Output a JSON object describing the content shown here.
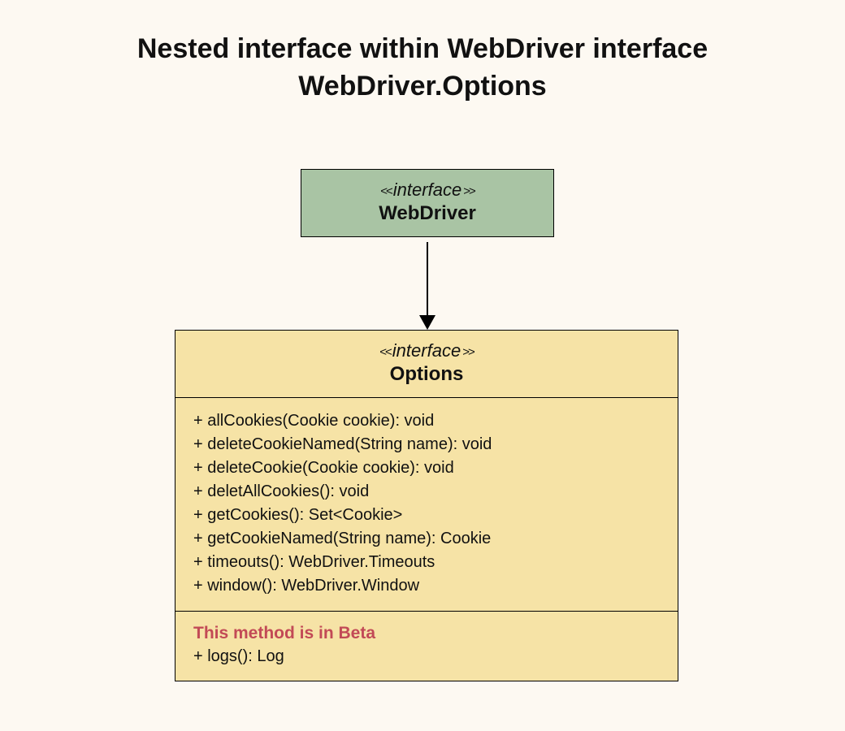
{
  "title_line1": "Nested interface within WebDriver interface",
  "title_line2": "WebDriver.Options",
  "stereotype_open": "<<",
  "stereotype_word": "interface",
  "stereotype_close": ">>",
  "webdriver": {
    "name": "WebDriver"
  },
  "options": {
    "name": "Options",
    "methods": [
      "+ allCookies(Cookie cookie): void",
      "+ deleteCookieNamed(String name): void",
      "+ deleteCookie(Cookie cookie): void",
      "+ deletAllCookies(): void",
      "+ getCookies(): Set<Cookie>",
      "+ getCookieNamed(String name): Cookie",
      "+ timeouts(): WebDriver.Timeouts",
      "+ window(): WebDriver.Window"
    ],
    "beta_note": "This method is in Beta",
    "beta_methods": [
      "+ logs(): Log"
    ]
  },
  "colors": {
    "page_bg": "#fdf9f2",
    "webdriver_bg": "#a9c4a4",
    "options_bg": "#f6e3a6",
    "beta_text": "#c24a56"
  }
}
